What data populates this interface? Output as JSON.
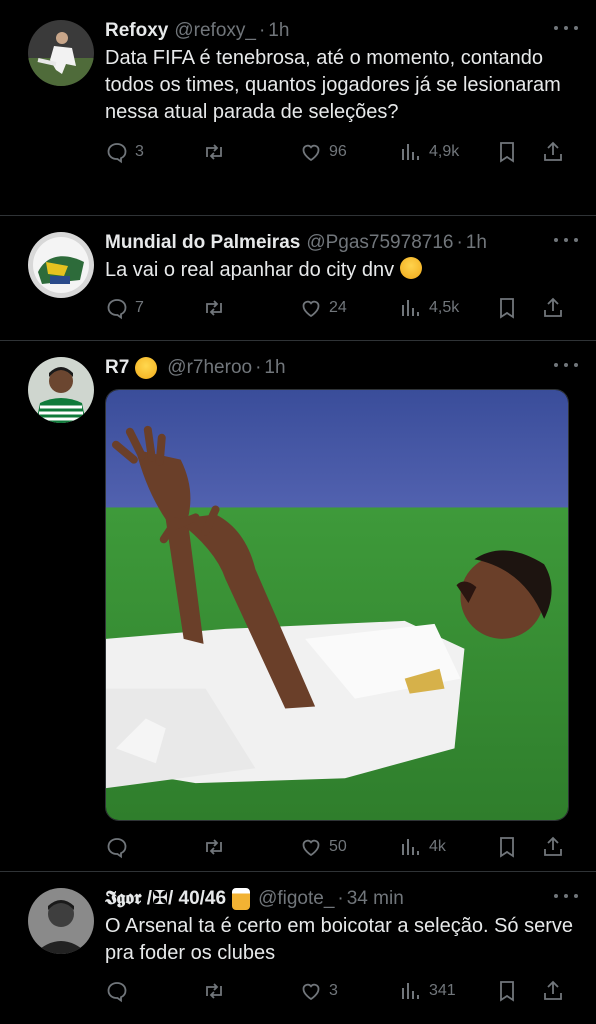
{
  "tweets": [
    {
      "name": "Refoxy",
      "handle": "@refoxy_",
      "time": "1h",
      "text": "Data FIFA é tenebrosa, até o momento, contando todos os times, quantos jogadores já se lesionaram nessa atual parada de seleções?",
      "replies": "3",
      "retweets": "",
      "likes": "96",
      "views": "4,9k"
    },
    {
      "name": "Mundial do Palmeiras",
      "handle": "@Pgas75978716",
      "time": "1h",
      "text": "La vai o real apanhar do city dnv",
      "emoji": "loudly-crying-face",
      "replies": "7",
      "retweets": "",
      "likes": "24",
      "views": "4,5k"
    },
    {
      "name": "R7",
      "emoji": "slightly-smiling-face",
      "handle": "@r7heroo",
      "time": "1h",
      "media": "photo-football-player-celebrating",
      "replies": "",
      "retweets": "",
      "likes": "50",
      "views": "4k"
    },
    {
      "name": "𝕴𝖌𝖔𝖗 /✠/ 40/46",
      "emoji": "beer-mug",
      "handle": "@figote_",
      "time": "34 min",
      "text": "O Arsenal ta é certo em boicotar a seleção. Só serve pra foder os clubes",
      "replies": "",
      "retweets": "",
      "likes": "3",
      "views": "341"
    }
  ],
  "icons": {
    "reply": "reply-icon",
    "retweet": "retweet-icon",
    "like": "heart-icon",
    "views": "views-chart-icon",
    "bookmark": "bookmark-icon",
    "share": "share-icon",
    "more": "more-dots-icon"
  },
  "colors": {
    "background": "#000000",
    "text": "#e7e9ea",
    "muted": "#71767b",
    "divider": "#2f3336"
  }
}
